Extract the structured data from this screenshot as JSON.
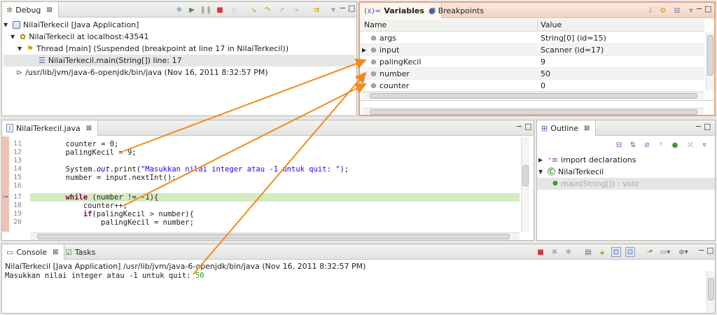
{
  "debug": {
    "tab_label": "Debug",
    "tree": [
      "NilaiTerkecil [Java Application]",
      "NilaiTerkecil at localhost:43541",
      "Thread [main] (Suspended (breakpoint at line 17 in NilaiTerkecil))",
      "NilaiTerkecil.main(String[]) line: 17",
      "/usr/lib/jvm/java-6-openjdk/bin/java (Nov 16, 2011 8:32:57 PM)"
    ]
  },
  "variables": {
    "tab_label": "Variables",
    "breakpoints_tab_label": "Breakpoints",
    "columns": [
      "Name",
      "Value"
    ],
    "rows": [
      {
        "name": "args",
        "value": "String[0]  (id=15)",
        "expandable": false
      },
      {
        "name": "input",
        "value": "Scanner  (id=17)",
        "expandable": true
      },
      {
        "name": "palingKecil",
        "value": "9",
        "expandable": false
      },
      {
        "name": "number",
        "value": "50",
        "expandable": false
      },
      {
        "name": "counter",
        "value": "0",
        "expandable": false
      }
    ]
  },
  "editor": {
    "tab_label": "NilaiTerkecil.java",
    "current_line": "17",
    "lines": [
      {
        "n": "11",
        "text": "        counter = 0;"
      },
      {
        "n": "12",
        "text": "        palingKecil = 9;"
      },
      {
        "n": "13",
        "text": ""
      },
      {
        "n": "14",
        "pre": "        System.",
        "it": "out",
        "mid": ".print(",
        "str": "\"Masukkan nilai integer atau -1 untuk quit: \"",
        "post": ");"
      },
      {
        "n": "15",
        "text": "        number = input.nextInt();"
      },
      {
        "n": "16",
        "text": ""
      },
      {
        "n": "17",
        "kw": "while",
        "post": " (number != -1){"
      },
      {
        "n": "18",
        "text": "            counter++;"
      },
      {
        "n": "19",
        "kw2": "if",
        "post": "(palingKecil > number){"
      },
      {
        "n": "20",
        "text": "                palingKecil = number;"
      }
    ]
  },
  "outline": {
    "tab_label": "Outline",
    "items": [
      "import declarations",
      "NilaiTerkecil",
      "main(String[]) : void"
    ]
  },
  "console": {
    "tab_label": "Console",
    "tasks_tab_label": "Tasks",
    "header": "NilaiTerkecil [Java Application] /usr/lib/jvm/java-6-openjdk/bin/java (Nov 16, 2011 8:32:57 PM)",
    "prompt": "Masukkan nilai integer atau -1 untuk quit: ",
    "input": "50"
  },
  "colors": {
    "annotation_arrow": "#f28a1c",
    "current_line_highlight": "#d4ebc0",
    "variables_border": "#e9a282"
  }
}
